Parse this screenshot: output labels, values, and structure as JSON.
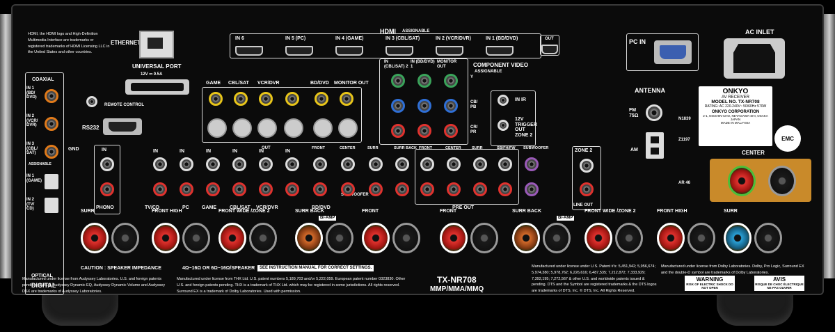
{
  "hdmi": {
    "title": "HDMI",
    "assignable": "ASSIGNABLE",
    "inputs": [
      "IN 6",
      "IN 5 (PC)",
      "IN 4 (GAME)",
      "IN 3 (CBL/SAT)",
      "IN 2 (VCR/DVR)",
      "IN 1 (BD/DVD)"
    ],
    "out": "OUT",
    "notice": "HDMI, the HDMI logo and High-Definition Multimedia Interface are trademarks or registered trademarks of HDMI Licensing LLC in the United States and other countries."
  },
  "ethernet": "ETHERNET",
  "universal_port": {
    "label": "UNIVERSAL PORT",
    "rating": "12V ⎓ 0.5A"
  },
  "remote_control": "REMOTE CONTROL",
  "rs232": "RS232",
  "gnd": "GND",
  "digital": {
    "coaxial": "COAXIAL",
    "coax_inputs": [
      "IN 1 (BD/ DVD)",
      "IN 2 (VCR/ DVR)",
      "IN 3 (CBL/ SAT)"
    ],
    "assignable": "ASSIGNABLE",
    "optical_inputs": [
      "IN 1 (GAME)",
      "IN 2 (TV/ CD)"
    ],
    "optical": "OPTICAL",
    "label": "DIGITAL"
  },
  "video_headers": [
    "GAME",
    "CBL/SAT",
    "VCR/DVR",
    "BD/DVD",
    "MONITOR OUT"
  ],
  "component_video": {
    "title": "COMPONENT VIDEO",
    "assignable": "ASSIGNABLE",
    "columns": [
      "IN (CBL/SAT) 2",
      "IN (BD/DVD) 1",
      "MONITOR OUT"
    ],
    "rows": [
      "Y",
      "CB/ PB",
      "CR/ PR"
    ]
  },
  "pc_in": "PC IN",
  "ir": {
    "in_ir": "IN IR",
    "trigger": "12V TRIGGER OUT ZONE 2"
  },
  "antenna": {
    "title": "ANTENNA",
    "fm": "FM 75Ω",
    "am": "AM"
  },
  "ac_inlet": "AC INLET",
  "brand_label": {
    "brand": "ONKYO",
    "type": "AV RECEIVER",
    "model": "MODEL NO. TX-NR708",
    "rating": "RATING: AC 220-240V~ 50/60Hz 570W",
    "corp": "ONKYO CORPORATION",
    "address": "2-1, NISSHIN-CHO, NEYAGAWA-SHI, OSAKA JAPAN",
    "made_in": "MADE IN MALAYSIA",
    "emc": "EMC",
    "n_code": "N1839",
    "z_code": "Z1197",
    "ar_code": "AR 46"
  },
  "audio_in": {
    "phono_in": "IN",
    "phono": "PHONO",
    "labels": [
      "TV/CD",
      "PC",
      "GAME",
      "CBL/SAT",
      "VCR/DVR",
      "BD/DVD"
    ],
    "in": "IN",
    "out": "OUT"
  },
  "pre_out": {
    "columns": [
      "FRONT",
      "CENTER",
      "SURR",
      "SURR BACK",
      "FRONT",
      "CENTER",
      "SURR",
      "SB/FH/FW",
      "SUBWOOFER"
    ],
    "subwoofer": "SUBWOOFER",
    "label": "PRE OUT",
    "zone2": "ZONE 2",
    "line_out": "LINE OUT"
  },
  "speakers": {
    "labels": [
      "SURR",
      "FRONT HIGH",
      "FRONT WIDE /ZONE 2",
      "SURR BACK",
      "FRONT",
      "FRONT",
      "SURR BACK",
      "FRONT WIDE /ZONE 2",
      "FRONT HIGH",
      "SURR"
    ],
    "center": "CENTER",
    "bi_amp": "Bi-AMP",
    "caution": "CAUTION : SPEAKER IMPEDANCE",
    "impedance": "4Ω~16Ω OR 6Ω~16Ω/SPEAKER",
    "manual": "SEE INSTRUCTION MANUAL FOR CORRECT SETTINGS."
  },
  "model": {
    "name": "TX-NR708",
    "variants": "MMP/MMA/MMQ"
  },
  "legal": {
    "audyssey": "Manufactured under license from Audyssey Laboratories. U.S. and foreign patents pending. MultEQ, Audyssey Dynamic EQ, Audyssey Dynamic Volume and Audyssey DSX are trademarks of Audyssey Laboratories.",
    "thx": "Manufactured under license from THX Ltd. U.S. patent numbers 5,189,703 and/or 5,222,059. European patent number 0323830. Other U.S. and foreign patents pending. THX is a trademark of THX Ltd. which may be registered in some jurisdictions. All rights reserved. Surround EX is a trademark of Dolby Laboratories. Used with permission.",
    "dts": "Manufactured under license under U.S. Patent #'s: 5,451,942; 5,956,674; 5,974,380; 5,978,762; 6,226,616; 6,487,535; 7,212,872; 7,333,929; 7,392,195; 7,272,567 & other U.S. and worldwide patents issued & pending. DTS and the Symbol are registered trademarks & the DTS logos are trademarks of DTS, Inc. © DTS, Inc. All Rights Reserved.",
    "dolby": "Manufactured under license from Dolby Laboratories. Dolby, Pro Logic, Surround EX and the double-D symbol are trademarks of Dolby Laboratories."
  },
  "warning": {
    "en_title": "WARNING",
    "en_text": "RISK OF ELECTRIC SHOCK DO NOT OPEN",
    "fr_title": "AVIS",
    "fr_text": "RISQUE DE CHOC ÉLECTRIQUE NE PAS OUVRIR"
  }
}
